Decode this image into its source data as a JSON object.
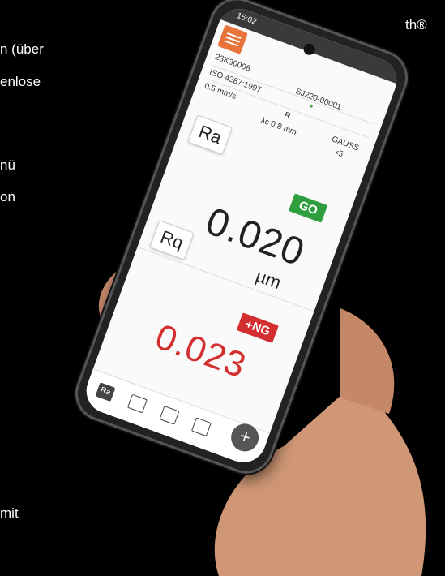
{
  "side_text": {
    "line1": "th®",
    "line2": "n (über",
    "line3": "enlose",
    "line4": "nü",
    "line5": "on",
    "line6": "mit"
  },
  "app": {
    "status_time": "16:02",
    "serial": "23K30006",
    "device": "SJ220-00001",
    "standard": "ISO 4287:1997",
    "speed": "0.5 mm/s",
    "profile": "R",
    "cutoff": "λc 0.8 mm",
    "filter": "GAUSS",
    "samples": "×5",
    "param1": "Ra",
    "param1_status": "GO",
    "param1_value": "0.020",
    "param1_unit": "µm",
    "param2": "Rq",
    "param2_status": "+NG",
    "param2_value": "0.023",
    "nav": [
      "Ra",
      "profile-icon",
      "graph-icon",
      "list-icon"
    ],
    "fab_label": "+"
  },
  "colors": {
    "accent": "#e8743b",
    "go": "#2e9e3e",
    "ng": "#d32f2f"
  }
}
